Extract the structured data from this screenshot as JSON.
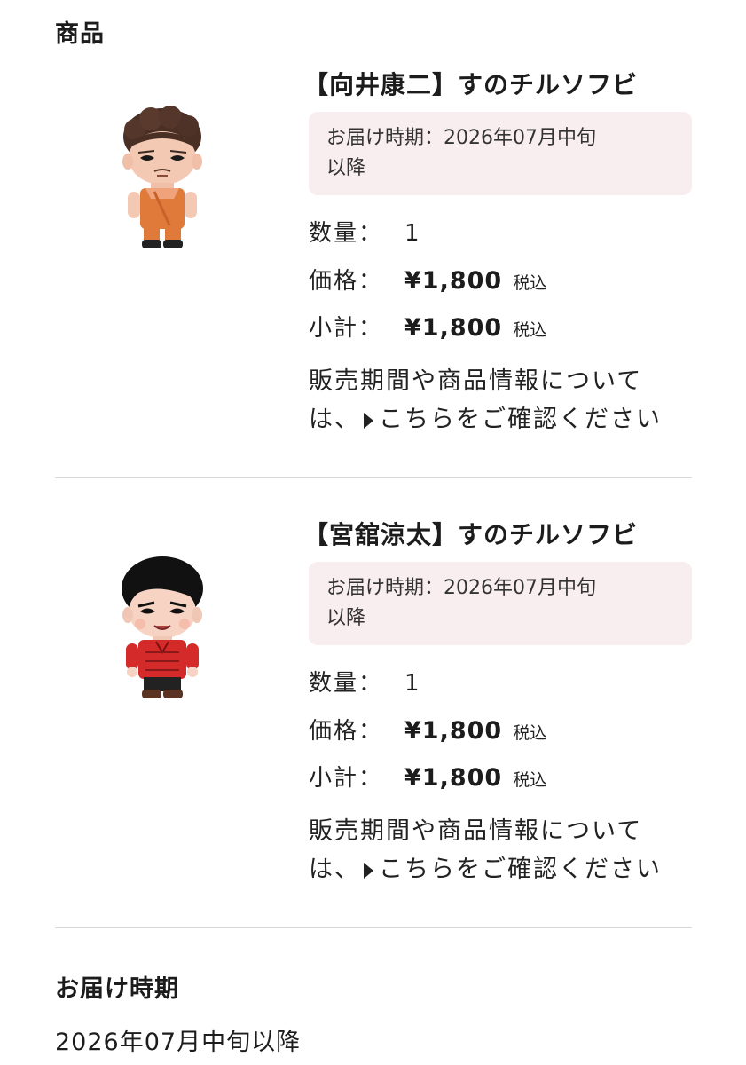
{
  "section": {
    "title": "商品"
  },
  "products": [
    {
      "name": "【向井康二】すのチルソフビ",
      "delivery_line1": "お届け時期：2026年07月中旬",
      "delivery_line2": "以降",
      "qty_label": "数量：",
      "qty_value": "1",
      "price_label": "価格：",
      "price_value": "¥1,800",
      "price_tax": "税込",
      "subtotal_label": "小計：",
      "subtotal_value": "¥1,800",
      "subtotal_tax": "税込",
      "note_line1": "販売期間や商品情報について",
      "note_prefix": "は、",
      "note_link": "こちらをご確認ください",
      "figure_icon": "figure-orange-outfit"
    },
    {
      "name": "【宮舘涼太】すのチルソフビ",
      "delivery_line1": "お届け時期：2026年07月中旬",
      "delivery_line2": "以降",
      "qty_label": "数量：",
      "qty_value": "1",
      "price_label": "価格：",
      "price_value": "¥1,800",
      "price_tax": "税込",
      "subtotal_label": "小計：",
      "subtotal_value": "¥1,800",
      "subtotal_tax": "税込",
      "note_line1": "販売期間や商品情報について",
      "note_prefix": "は、",
      "note_link": "こちらをご確認ください",
      "figure_icon": "figure-red-jacket"
    }
  ],
  "delivery": {
    "heading": "お届け時期",
    "value": "2026年07月中旬以降"
  },
  "colors": {
    "delivery_box_bg": "#f8eef0",
    "divider": "#d9d9d9",
    "text": "#1c1c1c"
  }
}
